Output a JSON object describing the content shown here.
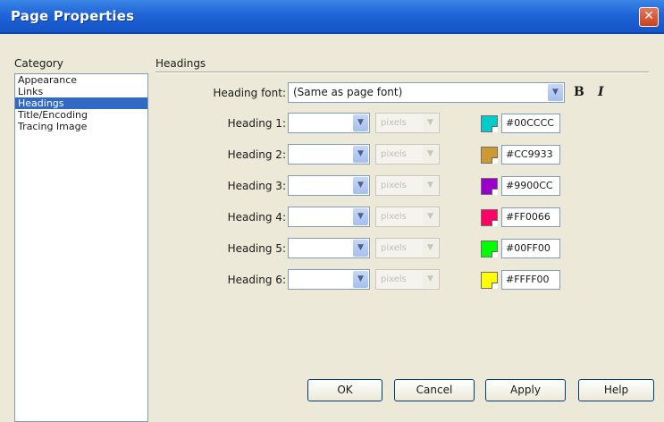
{
  "window": {
    "title": "Page Properties",
    "close_label": "✕"
  },
  "category": {
    "label": "Category",
    "items": [
      {
        "label": "Appearance"
      },
      {
        "label": "Links"
      },
      {
        "label": "Headings",
        "selected": true
      },
      {
        "label": "Title/Encoding"
      },
      {
        "label": "Tracing Image"
      }
    ]
  },
  "section": {
    "title": "Headings"
  },
  "heading_font": {
    "label": "Heading font:",
    "value": "(Same as page font)",
    "bold_label": "B",
    "italic_label": "I"
  },
  "headings": [
    {
      "label": "Heading 1:",
      "size": "",
      "unit": "pixels",
      "color": "#00CCCC",
      "hex": "#00CCCC"
    },
    {
      "label": "Heading 2:",
      "size": "",
      "unit": "pixels",
      "color": "#CC9933",
      "hex": "#CC9933"
    },
    {
      "label": "Heading 3:",
      "size": "",
      "unit": "pixels",
      "color": "#9900CC",
      "hex": "#9900CC"
    },
    {
      "label": "Heading 4:",
      "size": "",
      "unit": "pixels",
      "color": "#FF0066",
      "hex": "#FF0066"
    },
    {
      "label": "Heading 5:",
      "size": "",
      "unit": "pixels",
      "color": "#00FF00",
      "hex": "#00FF00"
    },
    {
      "label": "Heading 6:",
      "size": "",
      "unit": "pixels",
      "color": "#FFFF00",
      "hex": "#FFFF00"
    }
  ],
  "buttons": {
    "ok": "OK",
    "cancel": "Cancel",
    "apply": "Apply",
    "help": "Help"
  },
  "colors": {
    "titlebar": "#1f64d8",
    "selection": "#316ac5",
    "dialog_bg": "#ece9d8"
  }
}
